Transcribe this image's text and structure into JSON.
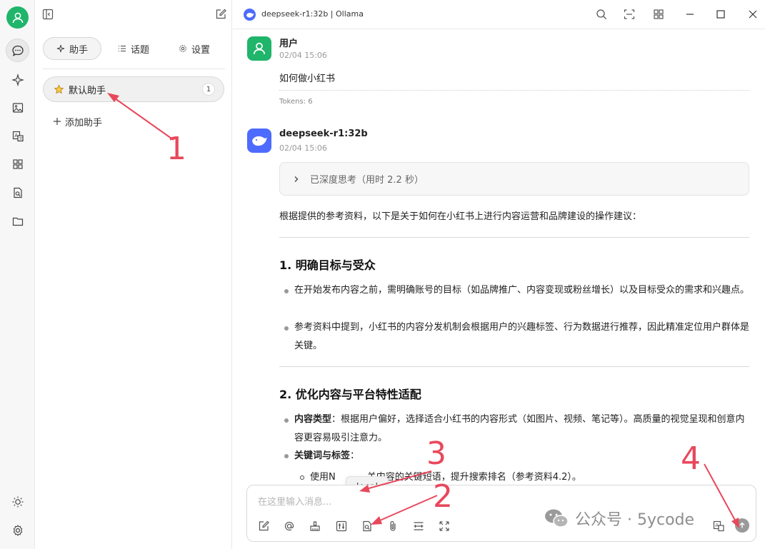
{
  "rail": {
    "items": [
      "chat-icon",
      "sparkle-icon",
      "image-icon",
      "translate-icon",
      "apps-icon",
      "document-search-icon",
      "folder-icon"
    ],
    "bottom": [
      "sun-icon",
      "gear-icon"
    ]
  },
  "panel": {
    "tabs": [
      {
        "label": "助手",
        "icon": "sparkle-icon"
      },
      {
        "label": "话题",
        "icon": "list-icon"
      },
      {
        "label": "设置",
        "icon": "gear-icon"
      }
    ],
    "assistant": {
      "label": "默认助手",
      "count": "1",
      "icon": "star-icon"
    },
    "add_label": "添加助手"
  },
  "topbar": {
    "title": "deepseek-r1:32b | Ollama"
  },
  "messages": {
    "user": {
      "name": "用户",
      "time": "02/04 15:06",
      "text": "如何做小红书",
      "tokens": "Tokens: 6"
    },
    "assistant": {
      "name": "deepseek-r1:32b",
      "time": "02/04 15:06",
      "thinking": "已深度思考（用时 2.2 秒）",
      "intro": "根据提供的参考资料，以下是关于如何在小红书上进行内容运营和品牌建设的操作建议：",
      "section1_title": "1. 明确目标与受众",
      "s1_b1": "在开始发布内容之前，需明确账号的目标（如品牌推广、内容变现或粉丝增长）以及目标受众的需求和兴趣点。",
      "s1_b2": "参考资料中提到，小红书的内容分发机制会根据用户的兴趣标签、行为数据进行推荐，因此精准定位用户群体是关键。",
      "section2_title": "2. 优化内容与平台特性适配",
      "s2_b1_label": "内容类型",
      "s2_b1_text": "：根据用户偏好，选择适合小红书的内容形式（如图片、视频、笔记等）。高质量的视觉呈现和创意内容更容易吸引注意力。",
      "s2_b2_label": "关键词与标签",
      "s2_b2_colon": "：",
      "s2_b3_a": "使用N",
      "s2_b3_b": "关内容的关键短语，提升搜索排名（参考资料4.2）。"
    }
  },
  "input": {
    "placeholder": "在这里输入消息...",
    "tooltip": "local",
    "icons": [
      "edit-icon",
      "at-icon",
      "broom-icon",
      "sliders-icon",
      "knowledge-base-icon",
      "attachment-icon",
      "divider-icon",
      "expand-icon"
    ]
  },
  "annotations": {
    "n1": "1",
    "n2": "2",
    "n3": "3",
    "n4": "4"
  },
  "watermark": {
    "text": "公众号 · 5ycode"
  },
  "colors": {
    "accent_green": "#1fb56a",
    "deepseek_blue": "#4d6bfe",
    "annotation_red": "#e8485c"
  }
}
